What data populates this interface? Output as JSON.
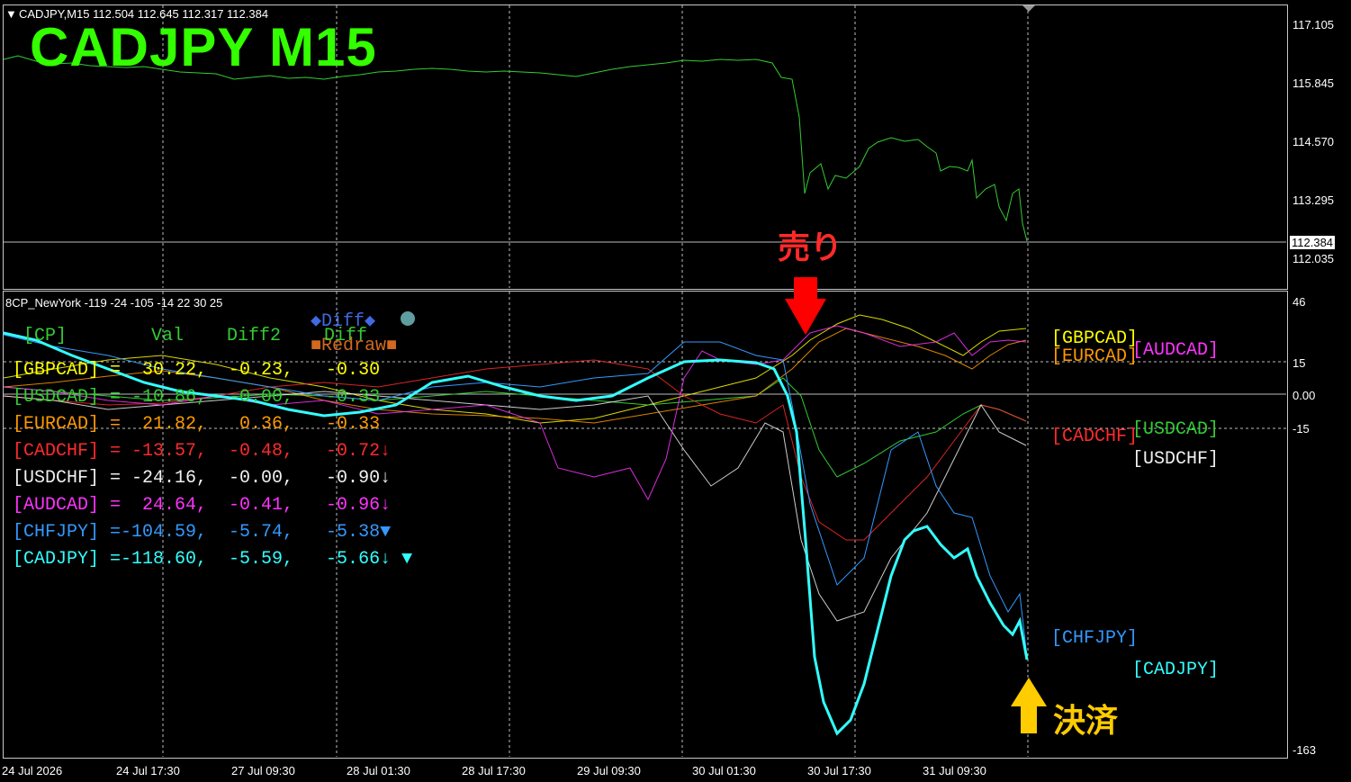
{
  "main_header": "CADJPY,M15  112.504 112.645 112.317 112.384",
  "big_title": "CADJPY  M15",
  "price_axis": [
    "117.105",
    "115.845",
    "114.570",
    "113.295",
    "112.035"
  ],
  "current_price": "112.384",
  "indicator_header": "8CP_NewYork -119 -24 -105 -14 22 30 25",
  "indicator_axis": [
    "46",
    "15",
    "0.00",
    "-15",
    "-163"
  ],
  "time_axis": [
    "24 Jul 2026",
    "24 Jul 17:30",
    "27 Jul 09:30",
    "28 Jul 01:30",
    "28 Jul 17:30",
    "29 Jul 09:30",
    "30 Jul 01:30",
    "30 Jul 17:30",
    "31 Jul 09:30"
  ],
  "buttons": {
    "diff": "◆Diff◆",
    "redraw": "■Redraw■"
  },
  "table": {
    "headers": [
      "[CP]",
      "Val",
      "Diff2",
      "Diff"
    ],
    "rows": [
      {
        "text": "[GBPCAD] =  30.22,  -0.23,   -0.30",
        "color": "#ffff00"
      },
      {
        "text": "[USDCAD] = -10.86,  -0.00,   -0.33",
        "color": "#33cc33"
      },
      {
        "text": "[EURCAD] =  21.82,   0.36,   -0.33",
        "color": "#ff9900"
      },
      {
        "text": "[CADCHF] = -13.57,  -0.48,   -0.72↓",
        "color": "#ff2a2a"
      },
      {
        "text": "[USDCHF] = -24.16,  -0.00,   -0.90↓",
        "color": "#f0f0f0"
      },
      {
        "text": "[AUDCAD] =  24.64,  -0.41,   -0.96↓",
        "color": "#ff33ff"
      },
      {
        "text": "[CHFJPY] =-104.59,  -5.74,   -5.38▼",
        "color": "#3399ff"
      },
      {
        "text": "[CADJPY] =-118.60,  -5.59,   -5.66↓ ▼",
        "color": "#33ffff"
      }
    ]
  },
  "legend": {
    "gbpcad": "[GBPCAD]",
    "eurcad": "[EURCAD]",
    "audcad": "[AUDCAD]",
    "cadchf": "[CADCHF]",
    "usdcad": "[USDCAD]",
    "usdchf": "[USDCHF]",
    "chfjpy": "[CHFJPY]",
    "cadjpy": "[CADJPY]"
  },
  "annotations": {
    "sell": "売り",
    "settle": "決済"
  },
  "colors": {
    "price_line": "#33cc33",
    "title": "#33ff00",
    "sell_arrow": "#ff0000",
    "settle_arrow": "#ffcc00",
    "gbpcad": "#ffff00",
    "usdcad": "#33cc33",
    "eurcad": "#ff9900",
    "cadchf": "#ff2a2a",
    "usdchf": "#f0f0f0",
    "audcad": "#ff33ff",
    "chfjpy": "#3399ff",
    "cadjpy": "#33ffff"
  }
}
